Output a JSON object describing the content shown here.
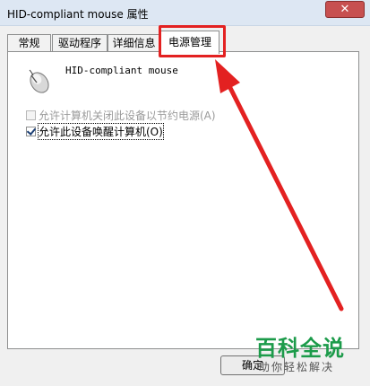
{
  "window": {
    "title": "HID-compliant mouse 属性",
    "close_label": "✕"
  },
  "tabs": [
    {
      "label": "常规"
    },
    {
      "label": "驱动程序"
    },
    {
      "label": "详细信息"
    },
    {
      "label": "电源管理"
    }
  ],
  "panel": {
    "device_name": "HID-compliant mouse",
    "device_icon": "mouse-icon",
    "options": [
      {
        "label": "允许计算机关闭此设备以节约电源(A)",
        "checked": false,
        "enabled": false
      },
      {
        "label": "允许此设备唤醒计算机(O)",
        "checked": true,
        "enabled": true
      }
    ]
  },
  "buttons": {
    "ok_label": "确定"
  },
  "watermark": {
    "main": "百科全说",
    "sub": "助你轻松解决"
  },
  "colors": {
    "annotation": "#e32121",
    "watermark": "#1c9b4a"
  }
}
